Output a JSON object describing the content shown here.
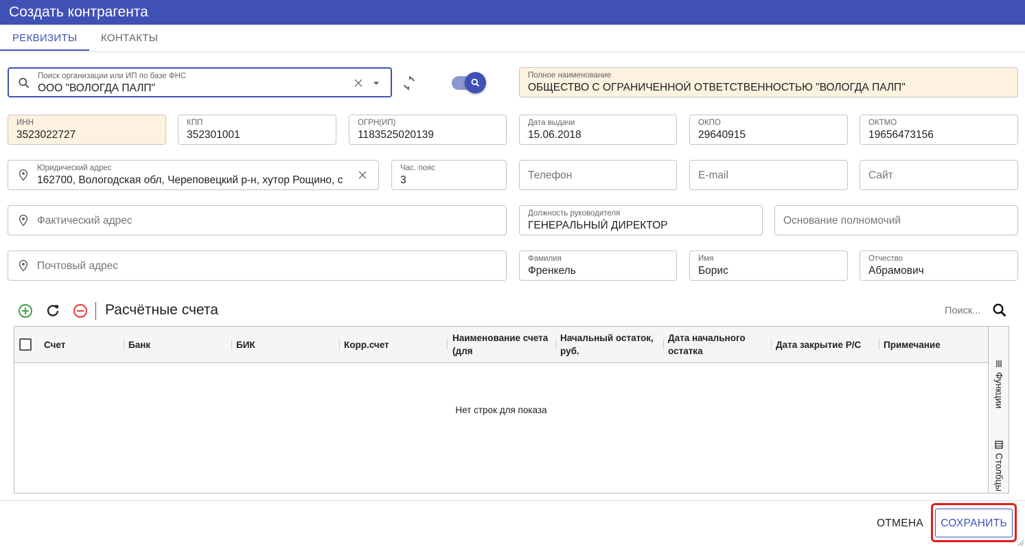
{
  "window": {
    "title": "Создать контрагента"
  },
  "tabs": [
    {
      "label": "РЕКВИЗИТЫ",
      "active": true
    },
    {
      "label": "КОНТАКТЫ",
      "active": false
    }
  ],
  "colors": {
    "accent": "#3f51b5",
    "highlight_field": "#fdf1df",
    "save_outline": "#e21c1c",
    "add": "#43a047",
    "remove": "#e53935"
  },
  "form": {
    "search": {
      "label": "Поиск организации или ИП по базе ФНС",
      "value": "ООО \"ВОЛОГДА ПАЛП\""
    },
    "full_name": {
      "label": "Полное наименование",
      "value": "ОБЩЕСТВО С ОГРАНИЧЕННОЙ ОТВЕТСТВЕННОСТЬЮ \"ВОЛОГДА ПАЛП\""
    },
    "inn": {
      "label": "ИНН",
      "value": "3523022727"
    },
    "kpp": {
      "label": "КПП",
      "value": "352301001"
    },
    "ogrn": {
      "label": "ОГРН(ИП)",
      "value": "1183525020139"
    },
    "issue_date": {
      "label": "Дата выдачи",
      "value": "15.06.2018"
    },
    "okpo": {
      "label": "ОКПО",
      "value": "29640915"
    },
    "oktmo": {
      "label": "ОКТМО",
      "value": "19656473156"
    },
    "legal_address": {
      "label": "Юридический адрес",
      "value": "162700, Вологодская обл, Череповецкий р-н, хутор Рощино, с"
    },
    "timezone": {
      "label": "Час. пояс",
      "value": "3"
    },
    "phone": {
      "placeholder": "Телефон"
    },
    "email": {
      "placeholder": "E-mail"
    },
    "site": {
      "placeholder": "Сайт"
    },
    "actual_address": {
      "placeholder": "Фактический адрес"
    },
    "head_position": {
      "label": "Должность руководителя",
      "value": "ГЕНЕРАЛЬНЫЙ ДИРЕКТОР"
    },
    "authority_basis": {
      "placeholder": "Основание полномочий"
    },
    "postal_address": {
      "placeholder": "Почтовый адрес"
    },
    "last_name": {
      "label": "Фамилия",
      "value": "Френкель"
    },
    "first_name": {
      "label": "Имя",
      "value": "Борис"
    },
    "patronymic": {
      "label": "Отчество",
      "value": "Абрамович"
    }
  },
  "accounts": {
    "title": "Расчётные счета",
    "search_placeholder": "Поиск...",
    "columns": [
      "Счет",
      "Банк",
      "БИК",
      "Корр.счет",
      "Наименование счета (для",
      "Начальный остаток, руб.",
      "Дата начального остатка",
      "Дата закрытие Р/С",
      "Примечание"
    ],
    "empty_message": "Нет строк для показа",
    "side_functions": "Функции",
    "side_columns": "Столбцы"
  },
  "footer": {
    "cancel_label": "ОТМЕНА",
    "save_label": "СОХРАНИТЬ"
  }
}
